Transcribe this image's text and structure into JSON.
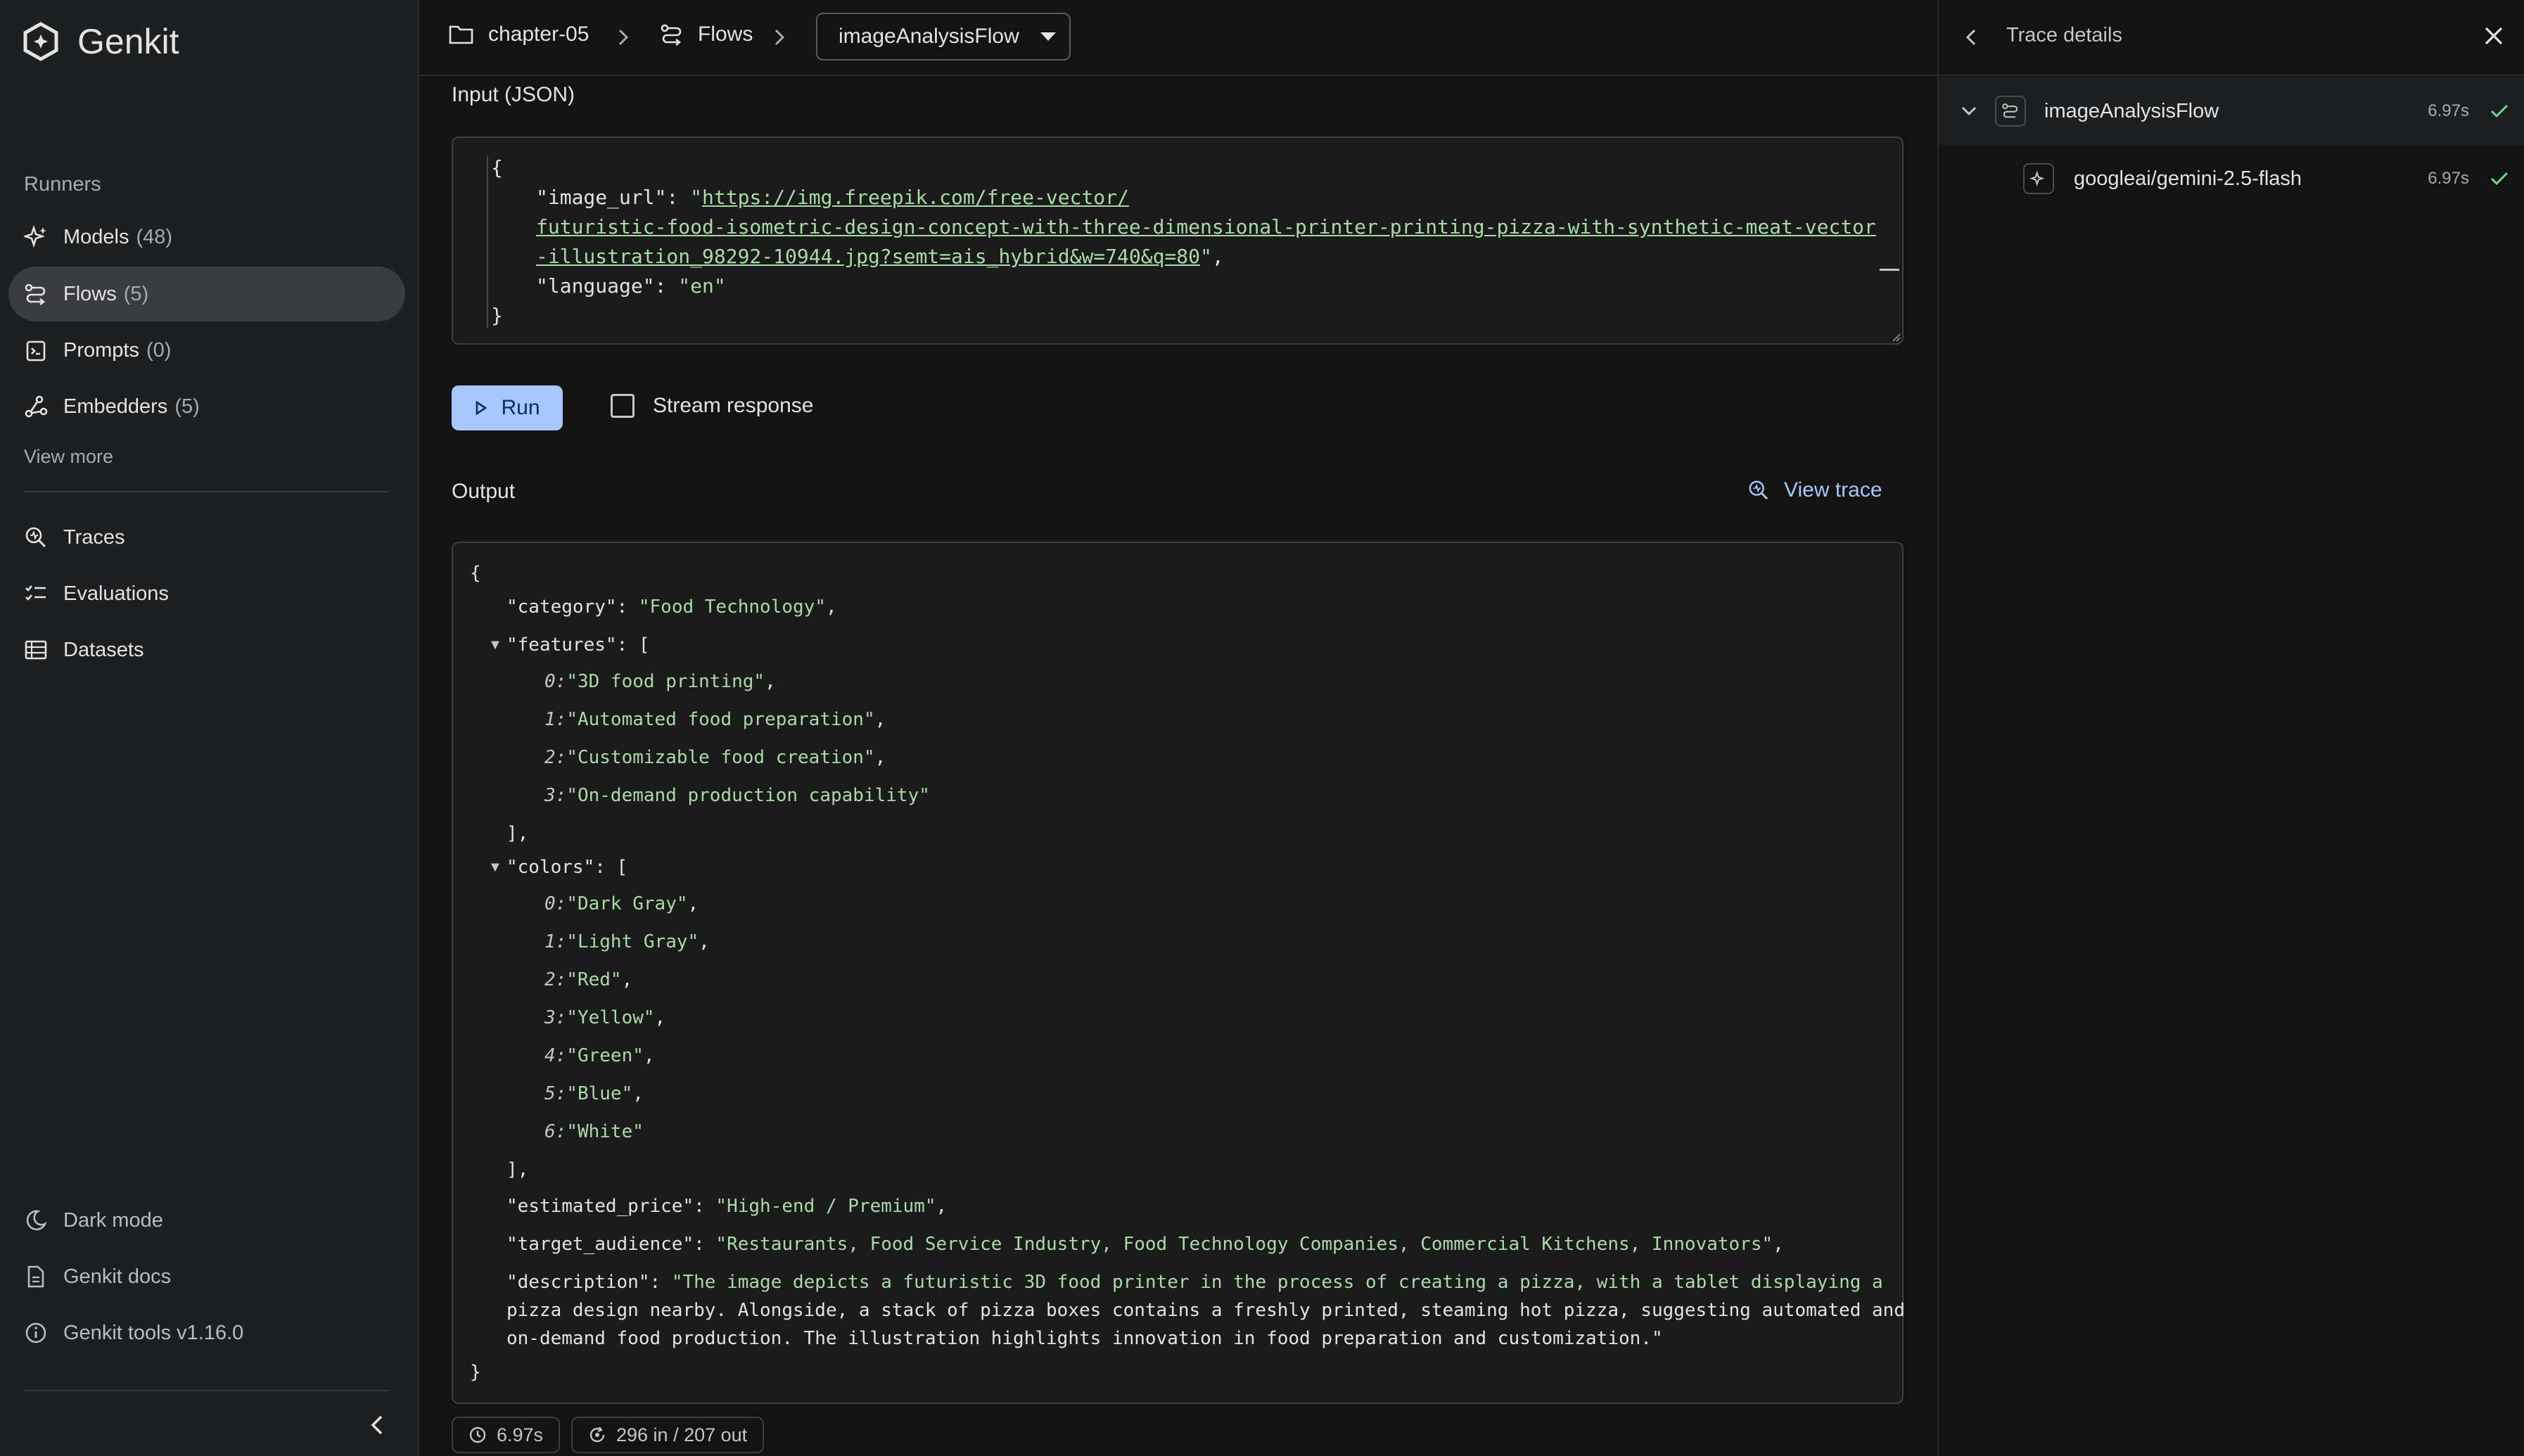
{
  "app": {
    "name": "Genkit"
  },
  "sidebar": {
    "runners_title": "Runners",
    "items": [
      {
        "label": "Models",
        "count": "(48)",
        "icon": "sparkle-icon"
      },
      {
        "label": "Flows",
        "count": "(5)",
        "icon": "flow-icon",
        "active": true
      },
      {
        "label": "Prompts",
        "count": "(0)",
        "icon": "prompt-icon"
      },
      {
        "label": "Embedders",
        "count": "(5)",
        "icon": "embedder-icon"
      }
    ],
    "view_more": "View more",
    "tools": [
      {
        "label": "Traces",
        "icon": "trace-search-icon"
      },
      {
        "label": "Evaluations",
        "icon": "checklist-icon"
      },
      {
        "label": "Datasets",
        "icon": "dataset-icon"
      }
    ],
    "footer": [
      {
        "label": "Dark mode",
        "icon": "moon-icon"
      },
      {
        "label": "Genkit docs",
        "icon": "document-icon"
      },
      {
        "label": "Genkit tools v1.16.0",
        "icon": "info-icon"
      }
    ]
  },
  "breadcrumb": {
    "project": "chapter-05",
    "section": "Flows",
    "flow": "imageAnalysisFlow"
  },
  "input": {
    "label": "Input (JSON)",
    "open": "{",
    "close": "}",
    "image_url_key": "\"image_url\": ",
    "image_url_line1": "https://img.freepik.com/free-vector/",
    "image_url_line2": "futuristic-food-isometric-design-concept-with-three-dimensional-printer-printing-pizza-with-synthetic-meat-vector",
    "image_url_line3": "-illustration_98292-10944.jpg?semt=ais_hybrid&w=740&q=80",
    "language_key": "\"language\": ",
    "language_value": "\"en\""
  },
  "controls": {
    "run_label": "Run",
    "stream_label": "Stream response"
  },
  "output": {
    "label": "Output",
    "view_trace": "View trace",
    "category_key": "\"category\"",
    "category_value": "\"Food Technology\"",
    "features_key": "\"features\"",
    "features": [
      "\"3D food printing\"",
      "\"Automated food preparation\"",
      "\"Customizable food creation\"",
      "\"On-demand production capability\""
    ],
    "colors_key": "\"colors\"",
    "colors": [
      "\"Dark Gray\"",
      "\"Light Gray\"",
      "\"Red\"",
      "\"Yellow\"",
      "\"Green\"",
      "\"Blue\"",
      "\"White\""
    ],
    "price_key": "\"estimated_price\"",
    "price_value": "\"High-end / Premium\"",
    "audience_key": "\"target_audience\"",
    "audience_value": "\"Restaurants, Food Service Industry, Food Technology Companies, Commercial Kitchens, Innovators\"",
    "description_key": "\"description\"",
    "description_line1": "\"The image depicts a futuristic 3D food printer in the process of creating a pizza, with a tablet displaying a",
    "description_line2": "pizza design nearby. Alongside, a stack of pizza boxes contains a freshly printed, steaming hot pizza, suggesting automated and",
    "description_line3": "on-demand food production. The illustration highlights innovation in food preparation and customization.\""
  },
  "stats": {
    "duration": "6.97s",
    "tokens": "296 in / 207 out"
  },
  "trace": {
    "title": "Trace details",
    "spans": [
      {
        "name": "imageAnalysisFlow",
        "time": "6.97s",
        "status": "success"
      },
      {
        "name": "googleai/gemini-2.5-flash",
        "time": "6.97s",
        "status": "success"
      }
    ]
  },
  "colors": {
    "accent": "#a8c7fa",
    "string": "#a8dba6",
    "success": "#6dd58c",
    "background": "#131314",
    "sidebar": "#1e1f20"
  }
}
